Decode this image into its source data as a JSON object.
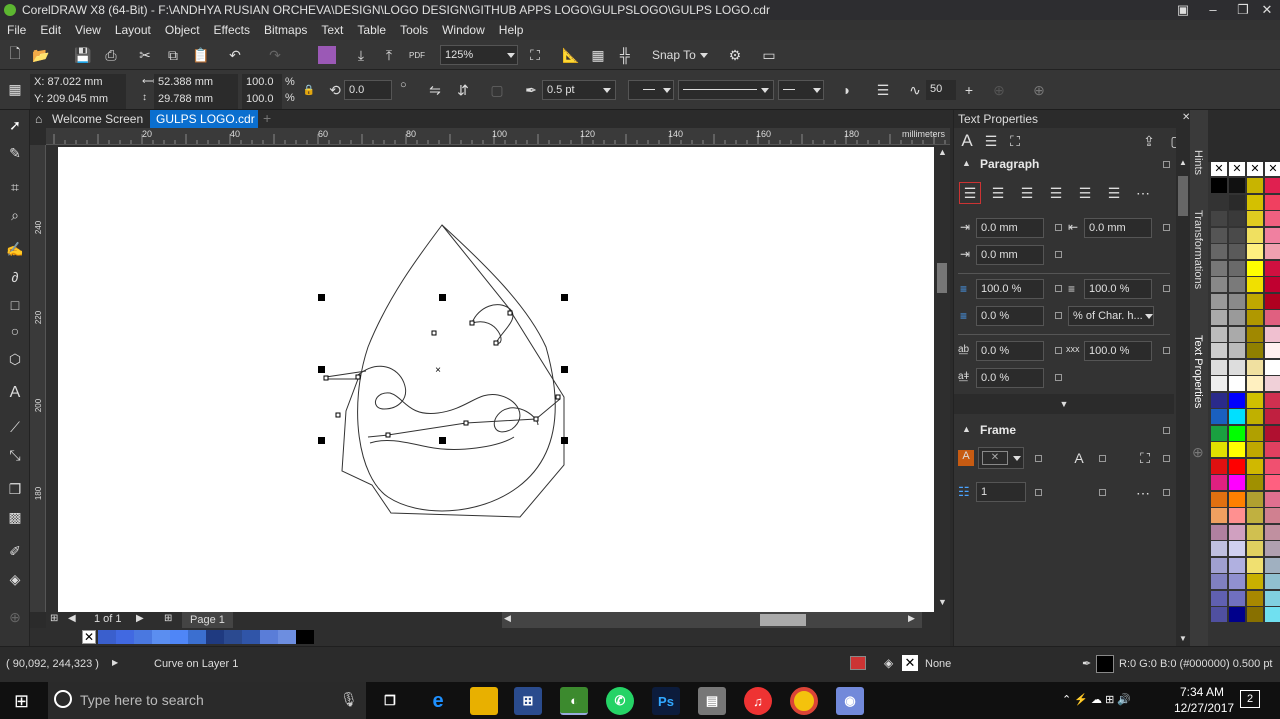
{
  "title": "CorelDRAW X8 (64-Bit) - F:\\ANDHYA RUSIAN ORCHEVA\\DESIGN\\LOGO DESIGN\\GITHUB APPS LOGO\\GULPSLOGO\\GULPS LOGO.cdr",
  "menu": [
    "File",
    "Edit",
    "View",
    "Layout",
    "Object",
    "Effects",
    "Bitmaps",
    "Text",
    "Table",
    "Tools",
    "Window",
    "Help"
  ],
  "toolbar": {
    "zoom": "125%",
    "snap": "Snap To"
  },
  "propbar": {
    "x": "X: 87.022 mm",
    "y": "Y: 209.045 mm",
    "w": "52.388 mm",
    "h": "29.788 mm",
    "sx": "100.0",
    "sy": "100.0",
    "pct": "%",
    "rot": "0.0",
    "outline": "0.5 pt",
    "smooth": "50"
  },
  "tabs": {
    "welcome": "Welcome Screen",
    "doc": "GULPS LOGO.cdr"
  },
  "ruler": {
    "h": [
      "20",
      "40",
      "60",
      "80",
      "100",
      "120",
      "140",
      "160",
      "180"
    ],
    "unit": "millimeters",
    "v": [
      "240",
      "220",
      "200",
      "180"
    ]
  },
  "pagebar": {
    "count": "1 of 1",
    "page": "Page 1"
  },
  "docker": {
    "title": "Text Properties",
    "paragraph": "Paragraph",
    "f1": "0.0 mm",
    "f2": "0.0 mm",
    "f3": "0.0 mm",
    "f4": "100.0 %",
    "f5": "100.0 %",
    "f6": "0.0 %",
    "f7": "% of Char. h...",
    "f8": "0.0 %",
    "f9": "100.0 %",
    "f10": "0.0 %",
    "frame": "Frame",
    "cols": "1"
  },
  "sidetabs": [
    "Hints",
    "Transformations",
    "Text Properties"
  ],
  "status": {
    "coords": "( 90,092, 244,323 )",
    "info": "Curve on Layer 1",
    "fill": "None",
    "outline": "R:0 G:0 B:0 (#000000)  0.500 pt"
  },
  "taskbar": {
    "search": "Type here to search",
    "time": "7:34 AM",
    "date": "12/27/2017",
    "notif": "2"
  }
}
